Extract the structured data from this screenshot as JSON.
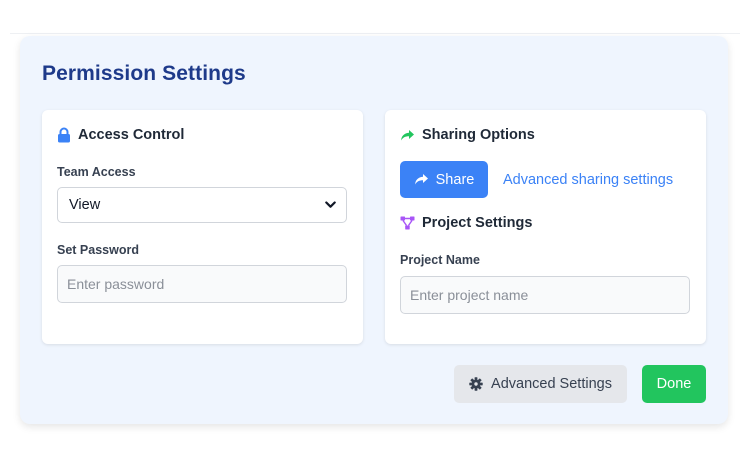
{
  "panel": {
    "title": "Permission Settings"
  },
  "access_control": {
    "heading": "Access Control",
    "icon": "lock-icon",
    "team_access_label": "Team Access",
    "team_access_value": "View",
    "password_label": "Set Password",
    "password_placeholder": "Enter password"
  },
  "sharing": {
    "heading": "Sharing Options",
    "icon": "share-arrow-icon",
    "share_button_label": "Share",
    "advanced_link": "Advanced sharing settings"
  },
  "project": {
    "heading": "Project Settings",
    "icon": "project-diagram-icon",
    "name_label": "Project Name",
    "name_placeholder": "Enter project name"
  },
  "footer": {
    "advanced_button_label": "Advanced Settings",
    "done_button_label": "Done"
  },
  "colors": {
    "title": "#1e3a8a",
    "primary": "#3b82f6",
    "success": "#22c55e",
    "lock": "#3b82f6",
    "share_icon": "#22c55e",
    "project_icon": "#a855f7"
  }
}
